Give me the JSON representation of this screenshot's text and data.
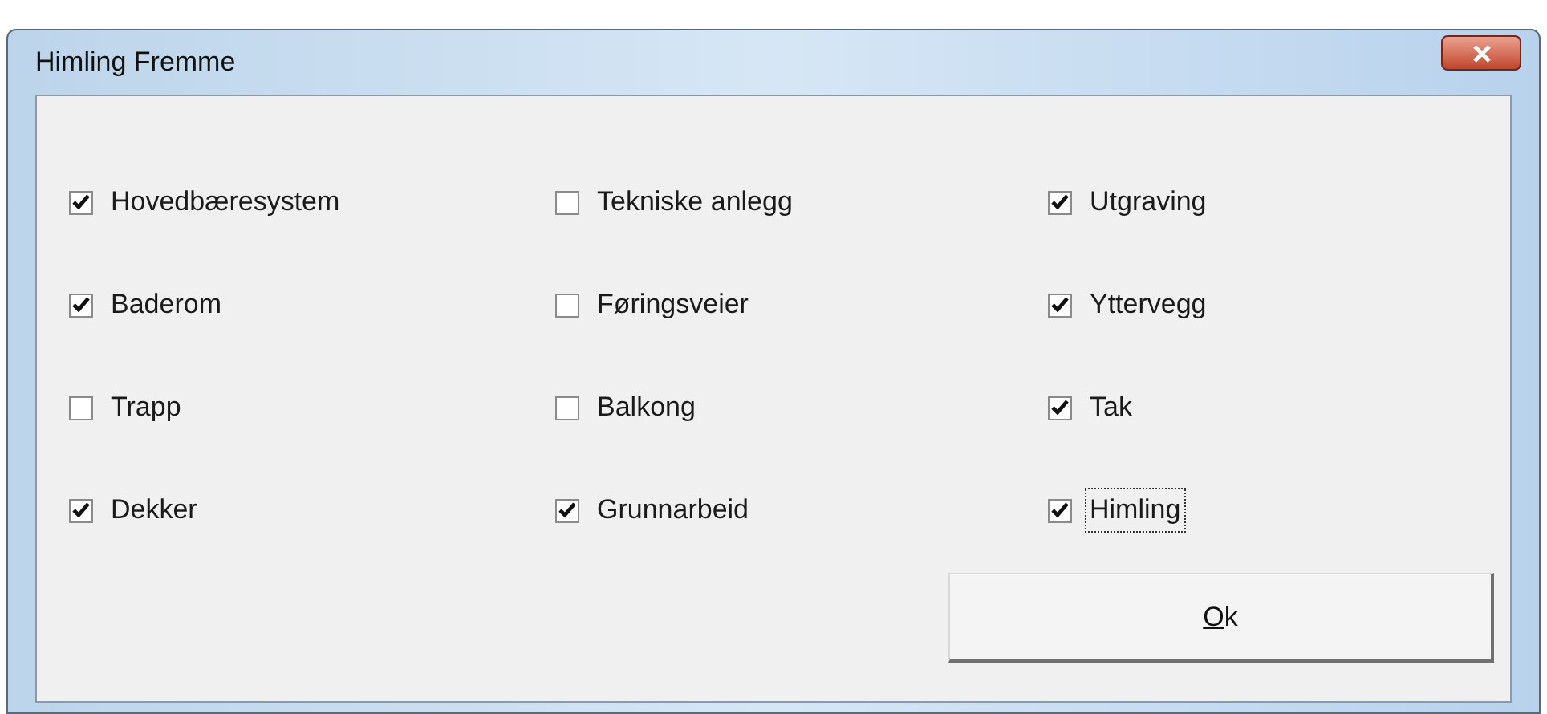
{
  "window": {
    "title": "Himling Fremme"
  },
  "checkboxes": [
    {
      "label": "Hovedbæresystem",
      "checked": true,
      "focused": false
    },
    {
      "label": "Tekniske anlegg",
      "checked": false,
      "focused": false
    },
    {
      "label": "Utgraving",
      "checked": true,
      "focused": false
    },
    {
      "label": "Baderom",
      "checked": true,
      "focused": false
    },
    {
      "label": "Føringsveier",
      "checked": false,
      "focused": false
    },
    {
      "label": "Yttervegg",
      "checked": true,
      "focused": false
    },
    {
      "label": "Trapp",
      "checked": false,
      "focused": false
    },
    {
      "label": "Balkong",
      "checked": false,
      "focused": false
    },
    {
      "label": "Tak",
      "checked": true,
      "focused": false
    },
    {
      "label": "Dekker",
      "checked": true,
      "focused": false
    },
    {
      "label": "Grunnarbeid",
      "checked": true,
      "focused": false
    },
    {
      "label": "Himling",
      "checked": true,
      "focused": true
    }
  ],
  "ok_button": {
    "label": "Ok",
    "first_letter_underlined": true
  }
}
